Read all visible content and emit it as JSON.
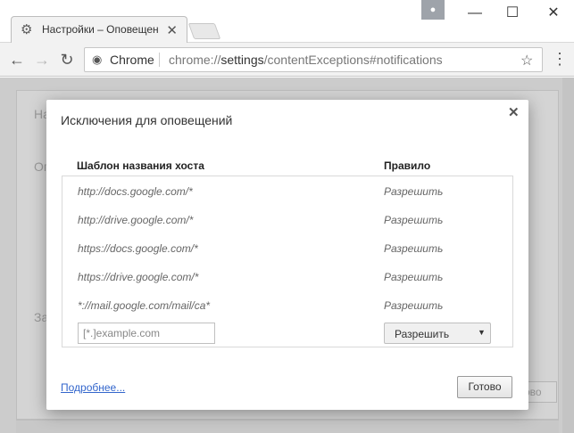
{
  "browser": {
    "tab": {
      "title": "Настройки – Оповещен",
      "icon": "gear-icon"
    },
    "address_bar": {
      "chip_label": "Chrome",
      "url_prefix": "chrome://",
      "url_host": "settings",
      "url_path": "/contentExceptions#notifications"
    }
  },
  "background_page": {
    "fragment_1": "На",
    "fragment_2": "Оп",
    "fragment_3": "За",
    "button_fragment": "ово"
  },
  "dialog": {
    "title": "Исключения для оповещений",
    "columns": {
      "pattern": "Шаблон названия хоста",
      "rule": "Правило"
    },
    "rows": [
      {
        "pattern": "http://docs.google.com/*",
        "rule": "Разрешить"
      },
      {
        "pattern": "http://drive.google.com/*",
        "rule": "Разрешить"
      },
      {
        "pattern": "https://docs.google.com/*",
        "rule": "Разрешить"
      },
      {
        "pattern": "https://drive.google.com/*",
        "rule": "Разрешить"
      },
      {
        "pattern": "*://mail.google.com/mail/ca*",
        "rule": "Разрешить"
      }
    ],
    "new_entry": {
      "placeholder": "[*.]example.com",
      "rule_selected": "Разрешить"
    },
    "learn_more": "Подробнее...",
    "done_label": "Готово"
  },
  "colors": {
    "link": "#3366cc",
    "overlay": "#cccccc"
  }
}
